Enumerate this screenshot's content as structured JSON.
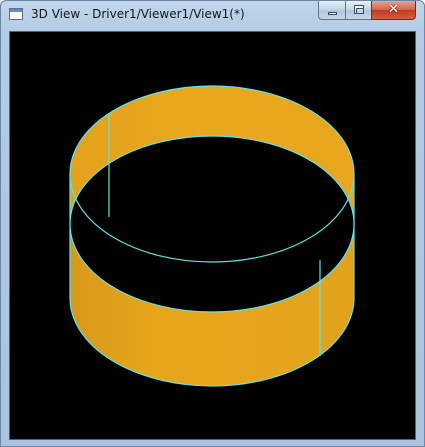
{
  "window": {
    "title": "3D View - Driver1/Viewer1/View1(*)",
    "icon": "window-app-icon",
    "controls": {
      "minimize_icon": "minimize-icon",
      "maximize_icon": "maximize-icon",
      "close_icon": "close-icon",
      "close_glyph": "✕"
    }
  },
  "viewport": {
    "background_color": "#000000",
    "shape": "open cylinder surface",
    "surface_color": "#e3a21c",
    "edge_color": "#5fe4e4"
  }
}
